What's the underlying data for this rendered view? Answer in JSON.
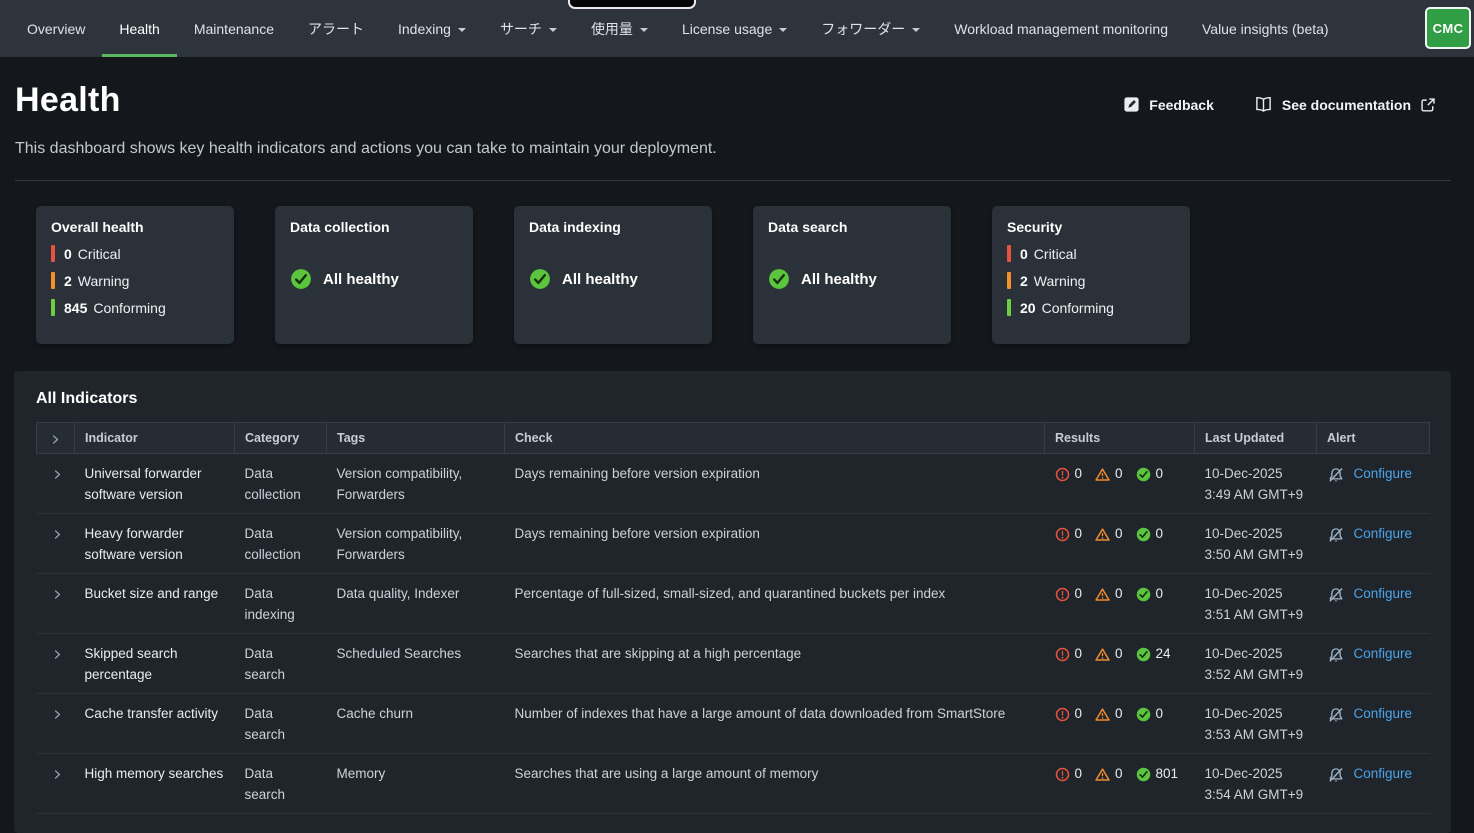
{
  "colors": {
    "accent_green": "#57b85c",
    "critical_red": "#e8533f",
    "warning_orange": "#f28a2e",
    "healthy_green": "#5bc53e",
    "conforming_bar_green": "#6fce3f",
    "link_blue": "#4da3e8",
    "nav_background": "#2e343b",
    "card_background": "#2b3138"
  },
  "nav": {
    "logo": "CMC",
    "items": [
      {
        "label": "Overview"
      },
      {
        "label": "Health"
      },
      {
        "label": "Maintenance"
      },
      {
        "label": "アラート"
      },
      {
        "label": "Indexing"
      },
      {
        "label": "サーチ"
      },
      {
        "label": "使用量"
      },
      {
        "label": "License usage"
      },
      {
        "label": "フォワーダー"
      },
      {
        "label": "Workload management monitoring"
      },
      {
        "label": "Value insights (beta)"
      }
    ]
  },
  "header": {
    "title": "Health",
    "description": "This dashboard shows key health indicators and actions you can take to maintain your deployment.",
    "feedback": "Feedback",
    "see_documentation": "See documentation"
  },
  "cards": {
    "overall": {
      "title": "Overall health",
      "critical": 0,
      "critical_label": "Critical",
      "warning": 2,
      "warning_label": "Warning",
      "conforming": 845,
      "conforming_label": "Conforming"
    },
    "collection": {
      "title": "Data collection",
      "status": "All healthy"
    },
    "indexing": {
      "title": "Data indexing",
      "status": "All healthy"
    },
    "search": {
      "title": "Data search",
      "status": "All healthy"
    },
    "security": {
      "title": "Security",
      "critical": 0,
      "critical_label": "Critical",
      "warning": 2,
      "warning_label": "Warning",
      "conforming": 20,
      "conforming_label": "Conforming"
    }
  },
  "table": {
    "title": "All Indicators",
    "columns": {
      "indicator": "Indicator",
      "category": "Category",
      "tags": "Tags",
      "check": "Check",
      "results": "Results",
      "updated": "Last Updated",
      "alert": "Alert"
    },
    "configure": "Configure",
    "rows": [
      {
        "indicator": "Universal forwarder software version",
        "category": "Data collection",
        "tags": "Version compatibility, Forwarders",
        "check": "Days remaining before version expiration",
        "critical": 0,
        "warning": 0,
        "ok": 0,
        "date": "10-Dec-2025",
        "time": "3:49 AM GMT+9"
      },
      {
        "indicator": "Heavy forwarder software version",
        "category": "Data collection",
        "tags": "Version compatibility, Forwarders",
        "check": "Days remaining before version expiration",
        "critical": 0,
        "warning": 0,
        "ok": 0,
        "date": "10-Dec-2025",
        "time": "3:50 AM GMT+9"
      },
      {
        "indicator": "Bucket size and range",
        "category": "Data indexing",
        "tags": "Data quality, Indexer",
        "check": "Percentage of full-sized, small-sized, and quarantined buckets per index",
        "critical": 0,
        "warning": 0,
        "ok": 0,
        "date": "10-Dec-2025",
        "time": "3:51 AM GMT+9"
      },
      {
        "indicator": "Skipped search percentage",
        "category": "Data search",
        "tags": "Scheduled Searches",
        "check": "Searches that are skipping at a high percentage",
        "critical": 0,
        "warning": 0,
        "ok": 24,
        "date": "10-Dec-2025",
        "time": "3:52 AM GMT+9"
      },
      {
        "indicator": "Cache transfer activity",
        "category": "Data search",
        "tags": "Cache churn",
        "check": "Number of indexes that have a large amount of data downloaded from SmartStore",
        "critical": 0,
        "warning": 0,
        "ok": 0,
        "date": "10-Dec-2025",
        "time": "3:53 AM GMT+9"
      },
      {
        "indicator": "High memory searches",
        "category": "Data search",
        "tags": "Memory",
        "check": "Searches that are using a large amount of memory",
        "critical": 0,
        "warning": 0,
        "ok": 801,
        "date": "10-Dec-2025",
        "time": "3:54 AM GMT+9"
      }
    ]
  }
}
